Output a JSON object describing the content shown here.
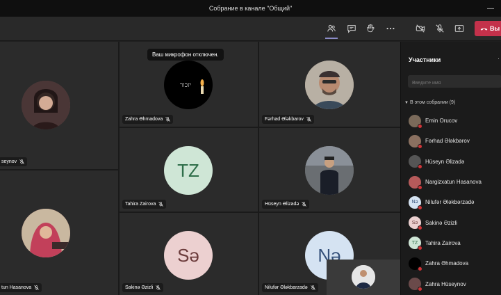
{
  "window": {
    "title": "Собрание в канале \"Общий\""
  },
  "toolbar": {
    "icons": [
      "participants-icon",
      "chat-icon",
      "raise-hand-icon",
      "more-icon",
      "camera-off-icon",
      "mic-off-icon",
      "share-icon"
    ],
    "leave_label": "Вы",
    "leave_color": "#c4314b"
  },
  "mic_notice": "Ваш микрофон отключен.",
  "tiles": [
    {
      "name": "Zahra Hüseynov",
      "label_shown": "seynov",
      "initials": "",
      "bg": "#6a4a4a"
    },
    {
      "name": "Zahra Əhmadova",
      "label_shown": "Zahra Əhmadova",
      "initials": "",
      "bg": "#000000",
      "avatar_text": "יזכור"
    },
    {
      "name": "Fərhad Ələkbarov",
      "label_shown": "Fərhad Ələkbarov",
      "initials": "",
      "bg": "#8a7a6a"
    },
    {
      "name": "Tahira Zairova",
      "label_shown": "Tahira Zairova",
      "initials": "TZ",
      "bg": "#cfe6d6",
      "fg": "#2f6e4a"
    },
    {
      "name": "Hüseyn Əlizadə",
      "label_shown": "Hüseyn Əlizadə",
      "initials": "",
      "bg": "#5a5a5a"
    },
    {
      "name": "Nargizxatun Hasanova",
      "label_shown": "tun Hasanova",
      "initials": "",
      "bg": "#b65a5a"
    },
    {
      "name": "Sakinə Əzizli",
      "label_shown": "Sakinə Əzizli",
      "initials": "Sə",
      "bg": "#ecd0d0",
      "fg": "#6b3b3b"
    },
    {
      "name": "Nilufər Ələkbarzadə",
      "label_shown": "Nilufər Ələkbarzadə",
      "initials": "Nə",
      "bg": "#d5e3f2",
      "fg": "#34507a"
    }
  ],
  "panel": {
    "title": "Участники",
    "search_placeholder": "Введите имя",
    "section_label": "В этом собрании (9)",
    "participants": [
      {
        "name": "Emin Orucov",
        "initials": "",
        "color": "#7a6a5a"
      },
      {
        "name": "Fərhad Ələkbərov",
        "initials": "",
        "color": "#8a7060"
      },
      {
        "name": "Hüseyn Əlizadə",
        "initials": "",
        "color": "#555555"
      },
      {
        "name": "Nargizxatun Hasanova",
        "initials": "",
        "color": "#b65a5a"
      },
      {
        "name": "Nilufər Ələkbərzadə",
        "initials": "Nə",
        "color": "#d5e3f2"
      },
      {
        "name": "Sakinə Əzizli",
        "initials": "Sə",
        "color": "#ecd0d0"
      },
      {
        "name": "Tahira Zairova",
        "initials": "TZ",
        "color": "#cfe6d6"
      },
      {
        "name": "Zahra Əhmadova",
        "initials": "",
        "color": "#000000"
      },
      {
        "name": "Zahra Hüseynov",
        "initials": "",
        "color": "#6a4a4a"
      }
    ]
  }
}
